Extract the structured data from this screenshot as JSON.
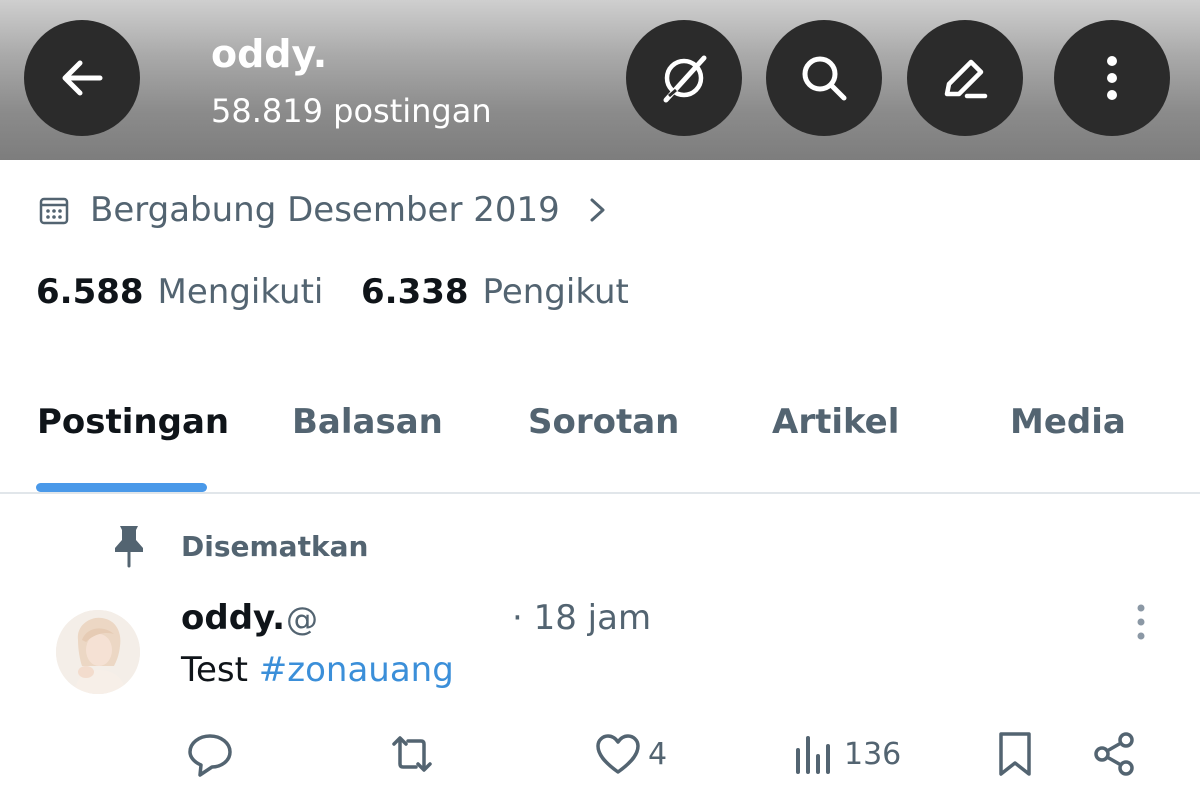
{
  "header": {
    "name": "oddy.",
    "post_count": "58.819 postingan",
    "colors": {
      "button_bg": "#2b2b2b",
      "icon": "#ffffff"
    },
    "icons": [
      "back-arrow-icon",
      "grok-icon",
      "search-icon",
      "edit-icon",
      "more-vertical-icon"
    ]
  },
  "profile": {
    "joined": "Bergabung Desember 2019",
    "following_count": "6.588",
    "following_label": "Mengikuti",
    "followers_count": "6.338",
    "followers_label": "Pengikut"
  },
  "tabs": [
    {
      "label": "Postingan",
      "active": true
    },
    {
      "label": "Balasan",
      "active": false
    },
    {
      "label": "Sorotan",
      "active": false
    },
    {
      "label": "Artikel",
      "active": false
    },
    {
      "label": "Media",
      "active": false
    }
  ],
  "pinned": {
    "label": "Disematkan"
  },
  "post": {
    "author": "oddy.",
    "handle": "@",
    "time": "· 18 jam",
    "text": "Test",
    "hashtag": "#zonauang",
    "likes": "4",
    "views": "136"
  },
  "colors": {
    "accent": "#4a99e9",
    "hashtag": "#3b8fd9",
    "secondary_text": "#536471",
    "primary_text": "#0f1419"
  }
}
